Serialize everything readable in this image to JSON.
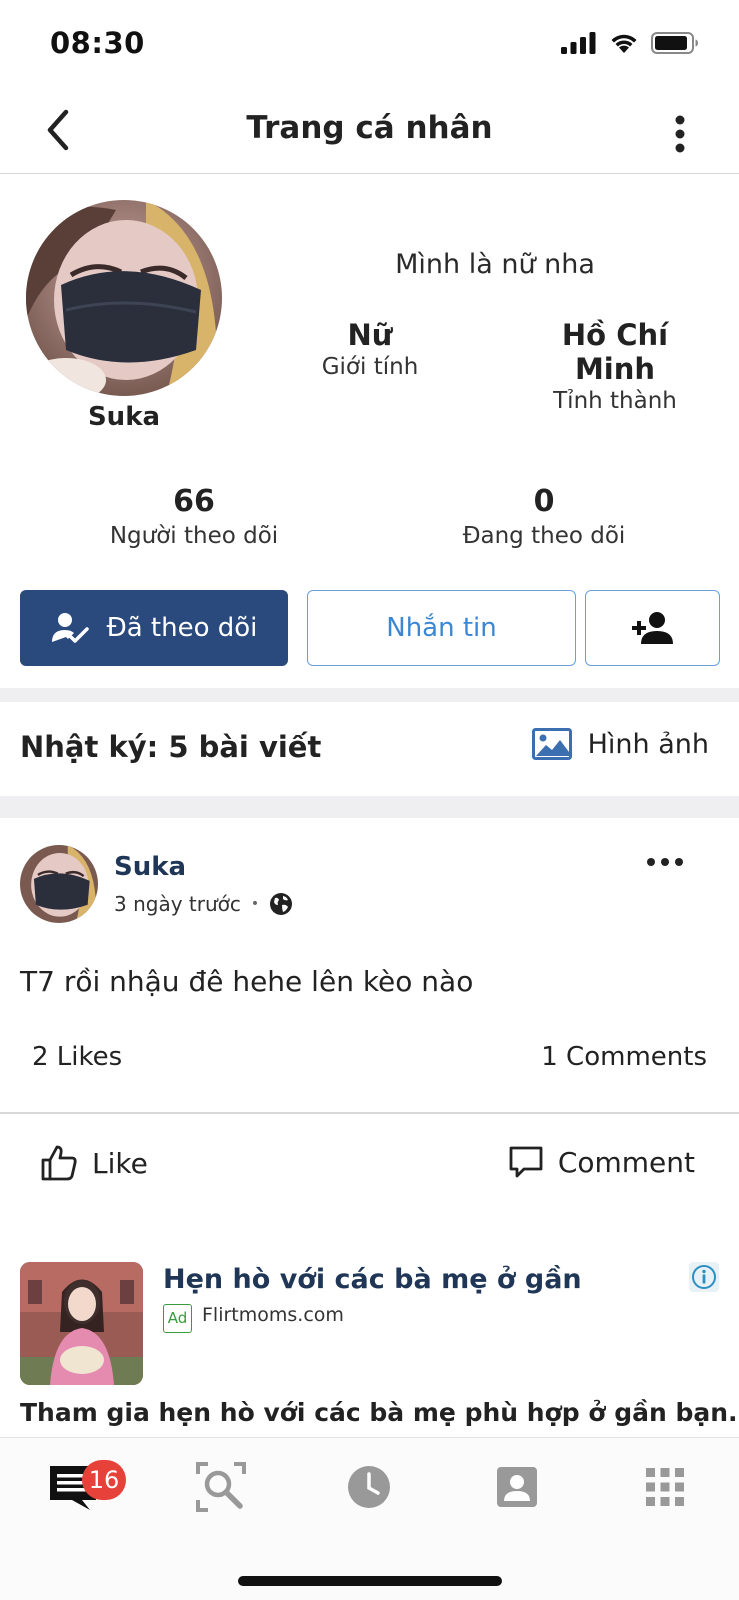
{
  "status_bar": {
    "time": "08:30"
  },
  "nav": {
    "title": "Trang cá nhân"
  },
  "profile": {
    "name": "Suka",
    "bio": "Mình là nữ nha",
    "gender_value": "Nữ",
    "gender_label": "Giới tính",
    "city_value": "Hồ Chí Minh",
    "city_label": "Tỉnh thành",
    "followers_count": "66",
    "followers_label": "Người theo dõi",
    "following_count": "0",
    "following_label": "Đang theo dõi"
  },
  "actions": {
    "followed_label": "Đã theo dõi",
    "message_label": "Nhắn tin"
  },
  "diary": {
    "title": "Nhật ký: 5 bài viết",
    "photos_label": "Hình ảnh"
  },
  "post": {
    "author": "Suka",
    "time": "3 ngày trước",
    "separator": "•",
    "text": "T7 rồi nhậu đê hehe lên kèo nào",
    "likes": "2 Likes",
    "comments": "1 Comments",
    "like_label": "Like",
    "comment_label": "Comment"
  },
  "ad": {
    "title": "Hẹn hò với các bà mẹ ở gần",
    "badge": "Ad",
    "domain": "Flirtmoms.com",
    "description": "Tham gia hẹn hò với các bà mẹ phù hợp ở gần bạn."
  },
  "tab_bar": {
    "badge_count": "16",
    "icons": [
      "messages-icon",
      "search-icon",
      "clock-icon",
      "profile-icon",
      "apps-grid-icon"
    ]
  },
  "colors": {
    "primary_button": "#2a4a7e",
    "link_blue": "#3b87d3",
    "author_navy": "#1f3656",
    "badge_red": "#e6423a"
  }
}
